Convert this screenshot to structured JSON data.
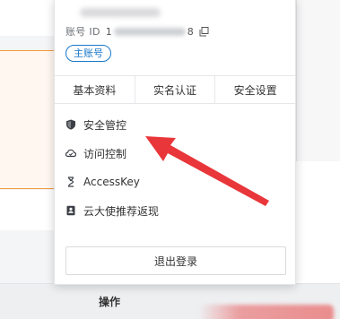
{
  "account_panel": {
    "account_id_label": "账号 ID",
    "account_id_prefix": "1",
    "account_id_suffix": "8",
    "badge_label": "主账号",
    "tabs": [
      "基本资料",
      "实名认证",
      "安全设置"
    ],
    "menu_items": [
      {
        "label": "安全管控",
        "icon": "shield-icon"
      },
      {
        "label": "访问控制",
        "icon": "cloud-icon"
      },
      {
        "label": "AccessKey",
        "icon": "key-icon"
      },
      {
        "label": "云大使推荐返现",
        "icon": "ambassador-icon"
      }
    ],
    "logout_label": "退出登录"
  },
  "background": {
    "operations_header": "操作"
  },
  "colors": {
    "accent_blue": "#1677c8",
    "annotation_red": "#e8363a",
    "orange_border": "#f09a3e"
  }
}
